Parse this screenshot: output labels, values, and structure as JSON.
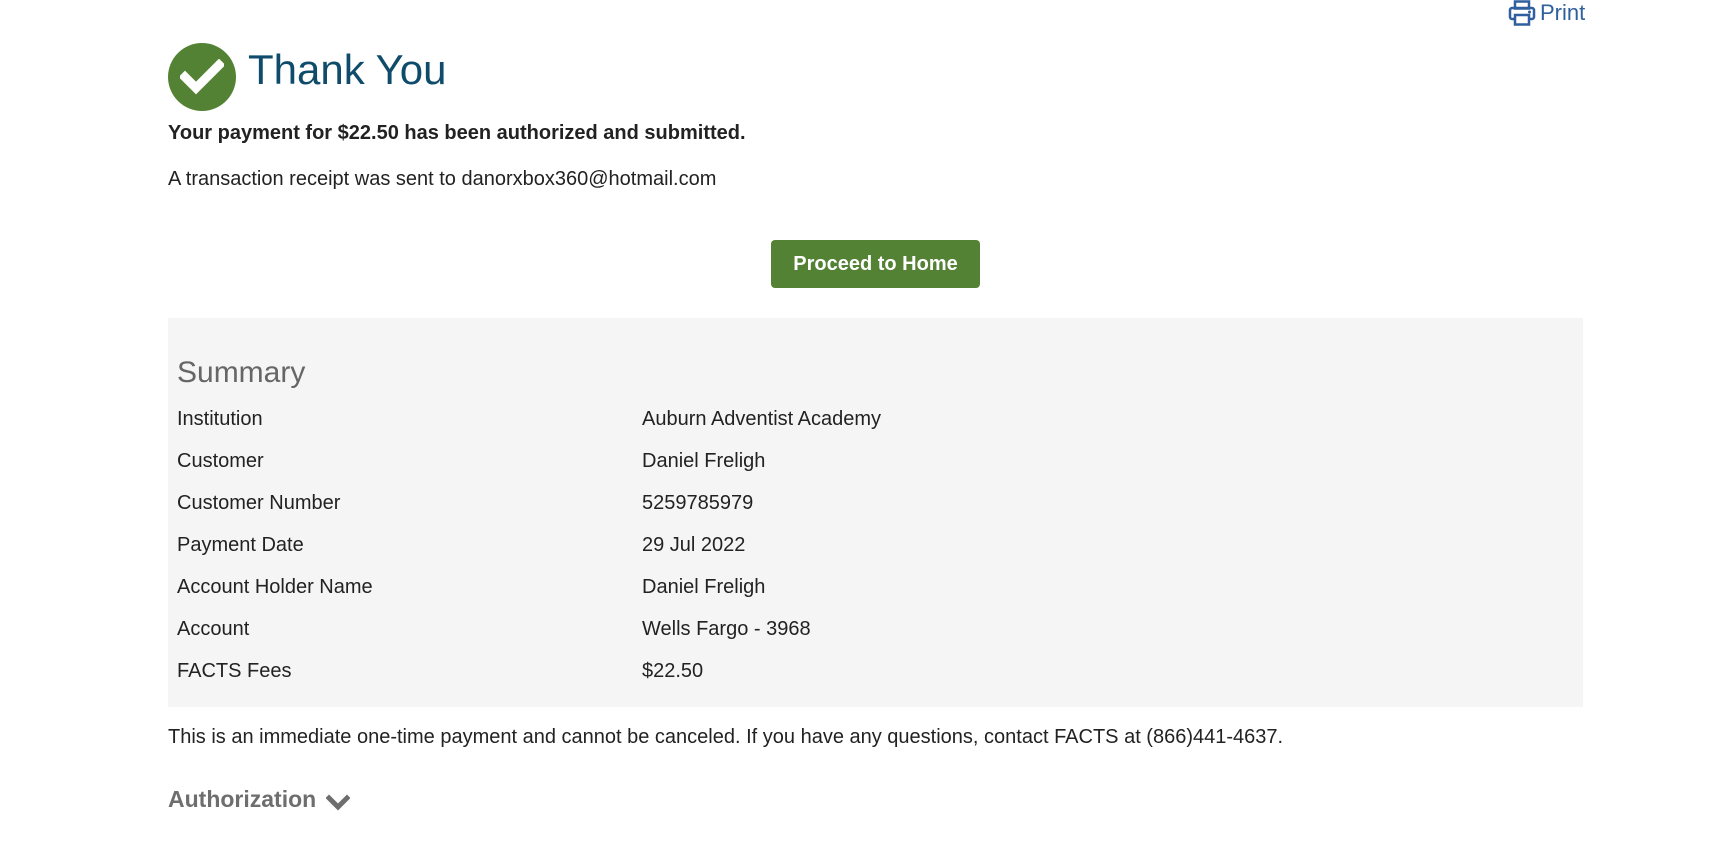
{
  "toolbar": {
    "print_label": "Print",
    "print_icon": "printer-icon"
  },
  "header": {
    "icon": "check-circle-icon",
    "title": "Thank You"
  },
  "confirmation": {
    "message": "Your payment for $22.50 has been authorized and submitted.",
    "receipt": "A transaction receipt was sent to danorxbox360@hotmail.com"
  },
  "actions": {
    "proceed_label": "Proceed to Home"
  },
  "summary": {
    "title": "Summary",
    "rows": [
      {
        "label": "Institution",
        "value": "Auburn Adventist Academy"
      },
      {
        "label": "Customer",
        "value": "Daniel Freligh"
      },
      {
        "label": "Customer Number",
        "value": "5259785979"
      },
      {
        "label": "Payment Date",
        "value": "29 Jul 2022"
      },
      {
        "label": "Account Holder Name",
        "value": "Daniel Freligh"
      },
      {
        "label": "Account",
        "value": "Wells Fargo - 3968"
      },
      {
        "label": "FACTS Fees",
        "value": "$22.50"
      }
    ]
  },
  "footer": {
    "disclaimer": "This is an immediate one-time payment and cannot be canceled. If you have any questions, contact FACTS at (866)441-4637.",
    "authorization_label": "Authorization",
    "authorization_icon": "chevron-down-icon"
  },
  "colors": {
    "brand_green": "#548235",
    "title_blue": "#0f4c6b",
    "link_blue": "#2f5f9e",
    "summary_bg": "#f5f5f5"
  }
}
